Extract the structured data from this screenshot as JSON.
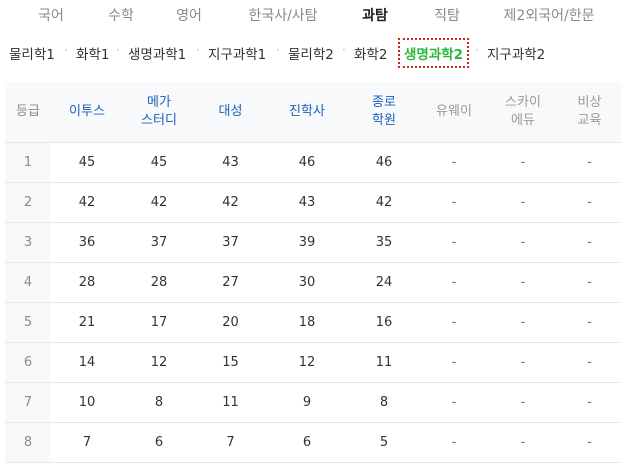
{
  "subject_tabs": [
    {
      "label": "국어",
      "active": false
    },
    {
      "label": "수학",
      "active": false
    },
    {
      "label": "영어",
      "active": false
    },
    {
      "label": "한국사/사탐",
      "active": false
    },
    {
      "label": "과탐",
      "active": true
    },
    {
      "label": "직탐",
      "active": false
    },
    {
      "label": "제2외국어/한문",
      "active": false
    }
  ],
  "sub_tabs": [
    {
      "label": "물리학1",
      "active": false
    },
    {
      "label": "화학1",
      "active": false
    },
    {
      "label": "생명과학1",
      "active": false
    },
    {
      "label": "지구과학1",
      "active": false
    },
    {
      "label": "물리학2",
      "active": false
    },
    {
      "label": "화학2",
      "active": false
    },
    {
      "label": "생명과학2",
      "active": true
    },
    {
      "label": "지구과학2",
      "active": false
    }
  ],
  "separator": "·",
  "table": {
    "headers": [
      {
        "line1": "등급",
        "line2": "",
        "style": "first"
      },
      {
        "line1": "이투스",
        "line2": "",
        "style": "blue"
      },
      {
        "line1": "메가",
        "line2": "스터디",
        "style": "blue"
      },
      {
        "line1": "대성",
        "line2": "",
        "style": "blue"
      },
      {
        "line1": "진학사",
        "line2": "",
        "style": "blue"
      },
      {
        "line1": "종로",
        "line2": "학원",
        "style": "blue"
      },
      {
        "line1": "유웨이",
        "line2": "",
        "style": "gray"
      },
      {
        "line1": "스카이",
        "line2": "에듀",
        "style": "gray"
      },
      {
        "line1": "비상",
        "line2": "교육",
        "style": "gray"
      }
    ],
    "rows": [
      [
        "1",
        "45",
        "45",
        "43",
        "46",
        "46",
        "-",
        "-",
        "-"
      ],
      [
        "2",
        "42",
        "42",
        "42",
        "43",
        "42",
        "-",
        "-",
        "-"
      ],
      [
        "3",
        "36",
        "37",
        "37",
        "39",
        "35",
        "-",
        "-",
        "-"
      ],
      [
        "4",
        "28",
        "28",
        "27",
        "30",
        "24",
        "-",
        "-",
        "-"
      ],
      [
        "5",
        "21",
        "17",
        "20",
        "18",
        "16",
        "-",
        "-",
        "-"
      ],
      [
        "6",
        "14",
        "12",
        "15",
        "12",
        "11",
        "-",
        "-",
        "-"
      ],
      [
        "7",
        "10",
        "8",
        "11",
        "9",
        "8",
        "-",
        "-",
        "-"
      ],
      [
        "8",
        "7",
        "6",
        "7",
        "6",
        "5",
        "-",
        "-",
        "-"
      ]
    ]
  }
}
